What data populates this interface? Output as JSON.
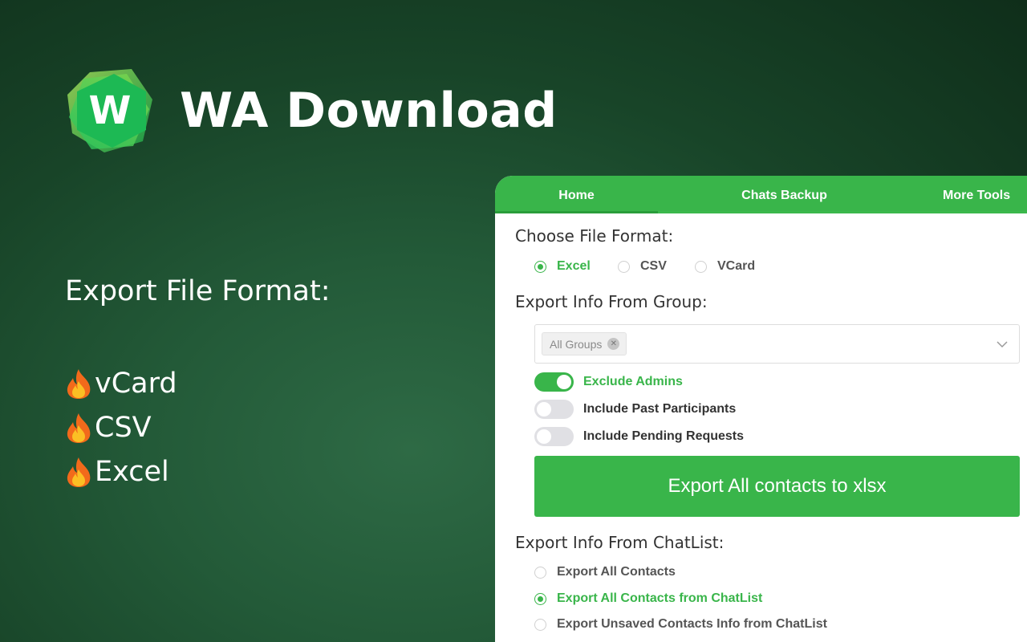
{
  "brand": {
    "logo_letter": "W",
    "title": "WA Download"
  },
  "features": {
    "heading": "Export File Format:",
    "items": [
      {
        "label": "vCard",
        "icon": "fire-icon"
      },
      {
        "label": "CSV",
        "icon": "fire-icon"
      },
      {
        "label": "Excel",
        "icon": "fire-icon"
      }
    ]
  },
  "panel": {
    "tabs": [
      {
        "label": "Home",
        "active": true
      },
      {
        "label": "Chats Backup",
        "active": false
      },
      {
        "label": "More Tools",
        "active": false
      }
    ],
    "file_format": {
      "title": "Choose File Format:",
      "options": [
        {
          "label": "Excel",
          "selected": true
        },
        {
          "label": "CSV",
          "selected": false
        },
        {
          "label": "VCard",
          "selected": false
        }
      ]
    },
    "group_export": {
      "title": "Export Info From Group:",
      "selected_tag": "All Groups",
      "toggles": [
        {
          "label": "Exclude Admins",
          "on": true
        },
        {
          "label": "Include Past Participants",
          "on": false
        },
        {
          "label": "Include Pending Requests",
          "on": false
        }
      ],
      "button_label": "Export All contacts to xlsx"
    },
    "chatlist_export": {
      "title": "Export Info From ChatList:",
      "options": [
        {
          "label": "Export All Contacts",
          "selected": false
        },
        {
          "label": "Export All Contacts from ChatList",
          "selected": true
        },
        {
          "label": "Export Unsaved Contacts Info from ChatList",
          "selected": false
        }
      ]
    }
  },
  "colors": {
    "accent": "#39b54a",
    "background_dark": "#0f2e1a",
    "background_light": "#2e6a45"
  }
}
